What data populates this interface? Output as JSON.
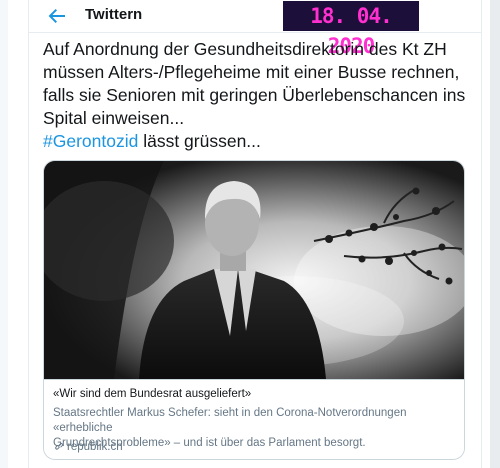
{
  "header": {
    "title": "Twittern",
    "date_overlay": "18. 04. 2020"
  },
  "tweet": {
    "text_lines": [
      "Auf Anordnung der Gesundheitsdirektorin des Kt ZH",
      "müssen Alters-/Pflegeheime mit einer Busse rechnen,",
      "falls sie Senioren mit geringen Überlebenschancen ins",
      "Spital einweisen..."
    ],
    "hashtag": "#Gerontozid",
    "hashtag_suffix": " lässt grüssen..."
  },
  "card": {
    "title": "«Wir sind dem Bundesrat ausgeliefert»",
    "description_lines": [
      "Staatsrechtler Markus Schefer: sieht in den Corona-Notverordnungen «erhebliche",
      "Grundrechtsprobleme» – und ist über das Parlament besorgt."
    ],
    "domain": "republik.ch"
  },
  "colors": {
    "accent": "#1b95e0",
    "text": "#14171a",
    "muted": "#657786",
    "border": "#ccd6dd",
    "date_bg": "#1c0f3a",
    "date_fg": "#ff2fd0"
  },
  "icons": {
    "back": "arrow-left-icon",
    "link": "link-icon"
  }
}
